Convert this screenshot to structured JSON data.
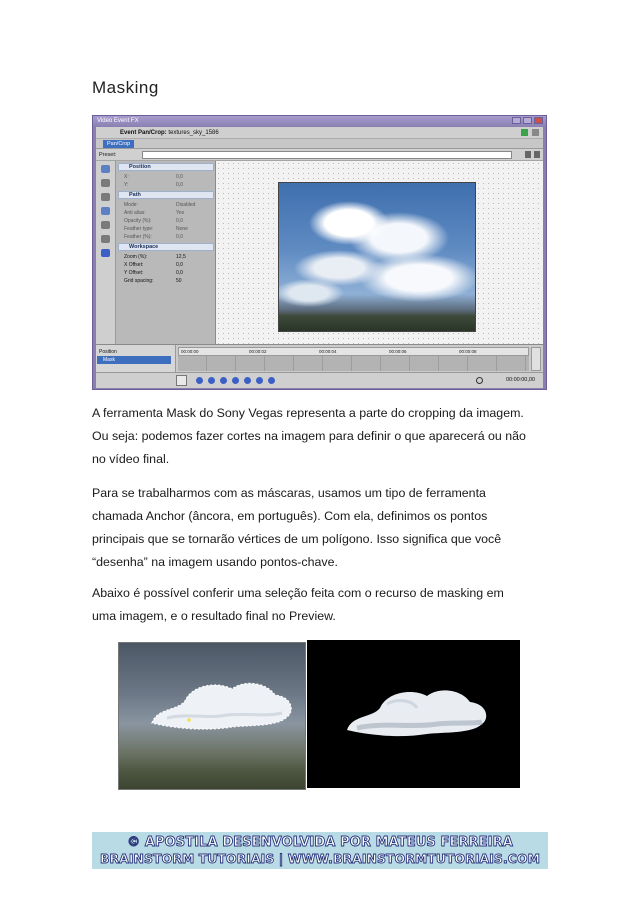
{
  "page": {
    "title": "Masking"
  },
  "screenshot": {
    "window_title": "Video Event FX",
    "event_label": "Event Pan/Crop:",
    "event_name": "textures_sky_1586",
    "tab_label": "Pan/Crop",
    "preset_label": "Preset:",
    "groups": {
      "position": "Position",
      "path": "Path",
      "workspace": "Workspace"
    },
    "position_props": [
      {
        "name": "X:",
        "value": "0,0"
      },
      {
        "name": "Y:",
        "value": "0,0"
      }
    ],
    "path_props": [
      {
        "name": "Mode:",
        "value": "Disabled"
      },
      {
        "name": "Anti alias:",
        "value": "Yes"
      },
      {
        "name": "Opacity (%):",
        "value": "0,0"
      },
      {
        "name": "Feather type:",
        "value": "None"
      },
      {
        "name": "Feather (%):",
        "value": "0,0"
      }
    ],
    "workspace_props": [
      {
        "name": "Zoom (%):",
        "value": "12,5"
      },
      {
        "name": "X Offset:",
        "value": "0,0"
      },
      {
        "name": "Y Offset:",
        "value": "0,0"
      },
      {
        "name": "Grid spacing:",
        "value": "50"
      }
    ],
    "timeline_items": [
      "Position",
      "Mask"
    ],
    "ruler_ticks": [
      "00:00:00",
      "00:00:02",
      "00:00:04",
      "00:00:06",
      "00:00:08"
    ],
    "timecode": "00:00:00,00"
  },
  "paragraphs": [
    [
      "A ferramenta Mask do Sony Vegas representa a parte do cropping da imagem.",
      "Ou seja: podemos fazer cortes na imagem para definir o que aparecerá ou não",
      "no vídeo final."
    ],
    [
      "Para se trabalharmos com as máscaras, usamos um tipo de ferramenta",
      "chamada Anchor (âncora, em português).  Com ela, definimos os pontos",
      "principais que se tornarão vértices de um polígono. Isso significa que você",
      "“desenha” na imagem usando pontos-chave."
    ],
    [
      "Abaixo é possível conferir uma seleção feita com o recurso de masking em",
      "uma imagem, e o resultado final no Preview."
    ]
  ],
  "footer": {
    "line1": "© APOSTILA DESENVOLVIDA POR MATEUS FERREIRA",
    "line2": "BRAINSTORM TUTORIAIS | WWW.BRAINSTORMTUTORIAIS.COM"
  },
  "colors": {
    "window_frame": "#8a7fb0",
    "selection_blue": "#3e6fbf",
    "banner_bg": "#b9dbe6",
    "banner_text_outline": "#26337a"
  }
}
